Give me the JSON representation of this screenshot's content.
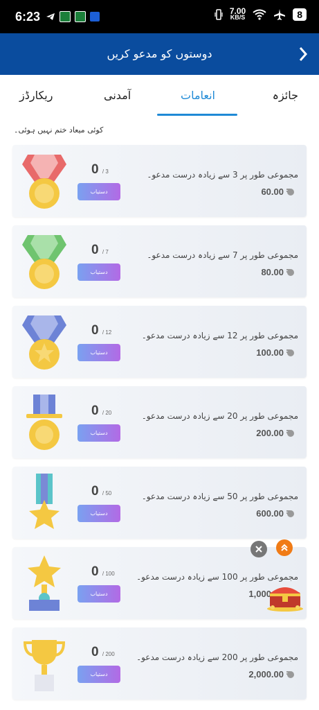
{
  "status": {
    "time": "6:23",
    "network_speed": "7.00",
    "network_unit": "KB/S",
    "battery": "8"
  },
  "header": {
    "title": "دوستوں کو مدعو کریں"
  },
  "tabs": [
    {
      "label": "جائزہ"
    },
    {
      "label": "انعامات"
    },
    {
      "label": "آمدنی"
    },
    {
      "label": "ریکارڈز"
    }
  ],
  "note": "کوئی میعاد ختم نہیں ہوئی۔",
  "cards": [
    {
      "count": "0",
      "target": "3",
      "button": "دستیاب",
      "desc": "مجموعی طور پر 3 سے زیادہ درست مدعو۔",
      "amount": "60.00"
    },
    {
      "count": "0",
      "target": "7",
      "button": "دستیاب",
      "desc": "مجموعی طور پر 7 سے زیادہ درست مدعو۔",
      "amount": "80.00"
    },
    {
      "count": "0",
      "target": "12",
      "button": "دستیاب",
      "desc": "مجموعی طور پر 12 سے زیادہ درست مدعو۔",
      "amount": "100.00"
    },
    {
      "count": "0",
      "target": "20",
      "button": "دستیاب",
      "desc": "مجموعی طور پر 20 سے زیادہ درست مدعو۔",
      "amount": "200.00"
    },
    {
      "count": "0",
      "target": "50",
      "button": "دستیاب",
      "desc": "مجموعی طور پر 50 سے زیادہ درست مدعو۔",
      "amount": "600.00"
    },
    {
      "count": "0",
      "target": "100",
      "button": "دستیاب",
      "desc": "مجموعی طور پر 100 سے زیادہ درست مدعو۔",
      "amount": "1,000.00"
    },
    {
      "count": "0",
      "target": "200",
      "button": "دستیاب",
      "desc": "مجموعی طور پر 200 سے زیادہ درست مدعو۔",
      "amount": "2,000.00"
    }
  ],
  "colors": {
    "header_bg": "#0a4c9e",
    "tab_active": "#1f8ad6",
    "button_gradient_start": "#7aa1f0",
    "button_gradient_end": "#b26ae5"
  }
}
